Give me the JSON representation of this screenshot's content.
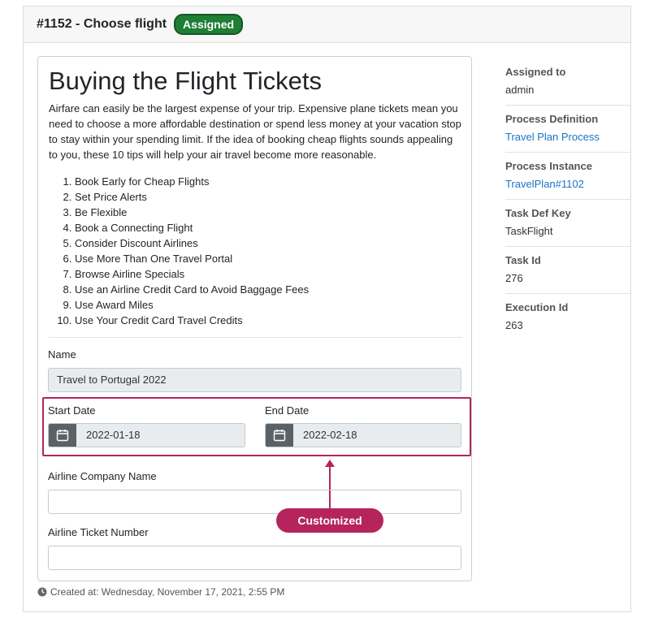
{
  "task": {
    "title": "#1152 - Choose flight",
    "status": "Assigned"
  },
  "form": {
    "heading": "Buying the Flight Tickets",
    "intro": "Airfare can easily be the largest expense of your trip. Expensive plane tickets mean you need to choose a more affordable destination or spend less money at your vacation stop to stay within your spending limit. If the idea of booking cheap flights sounds appealing to you, these 10 tips will help your air travel become more reasonable.",
    "tips": [
      "Book Early for Cheap Flights",
      "Set Price Alerts",
      "Be Flexible",
      "Book a Connecting Flight",
      "Consider Discount Airlines",
      "Use More Than One Travel Portal",
      "Browse Airline Specials",
      "Use an Airline Credit Card to Avoid Baggage Fees",
      "Use Award Miles",
      "Use Your Credit Card Travel Credits"
    ],
    "name_label": "Name",
    "name_value": "Travel to Portugal 2022",
    "start_date_label": "Start Date",
    "start_date_value": "2022-01-18",
    "end_date_label": "End Date",
    "end_date_value": "2022-02-18",
    "airline_label": "Airline Company Name",
    "airline_value": "",
    "ticket_label": "Airline Ticket Number",
    "ticket_value": ""
  },
  "annotation": {
    "label": "Customized",
    "color": "#b5245c"
  },
  "footer": {
    "created": "Created at: Wednesday, November 17, 2021, 2:55 PM"
  },
  "sidebar": {
    "assigned_to_label": "Assigned to",
    "assigned_to_value": "admin",
    "process_def_label": "Process Definition",
    "process_def_value": "Travel Plan Process",
    "process_inst_label": "Process Instance",
    "process_inst_value": "TravelPlan#1102",
    "task_def_key_label": "Task Def Key",
    "task_def_key_value": "TaskFlight",
    "task_id_label": "Task Id",
    "task_id_value": "276",
    "execution_id_label": "Execution Id",
    "execution_id_value": "263"
  },
  "icons": {
    "date": "calendar-icon",
    "footer": "clock-icon"
  },
  "colors": {
    "badge": "#1e7e34",
    "link": "#1a73c4",
    "accent": "#b5245c"
  }
}
